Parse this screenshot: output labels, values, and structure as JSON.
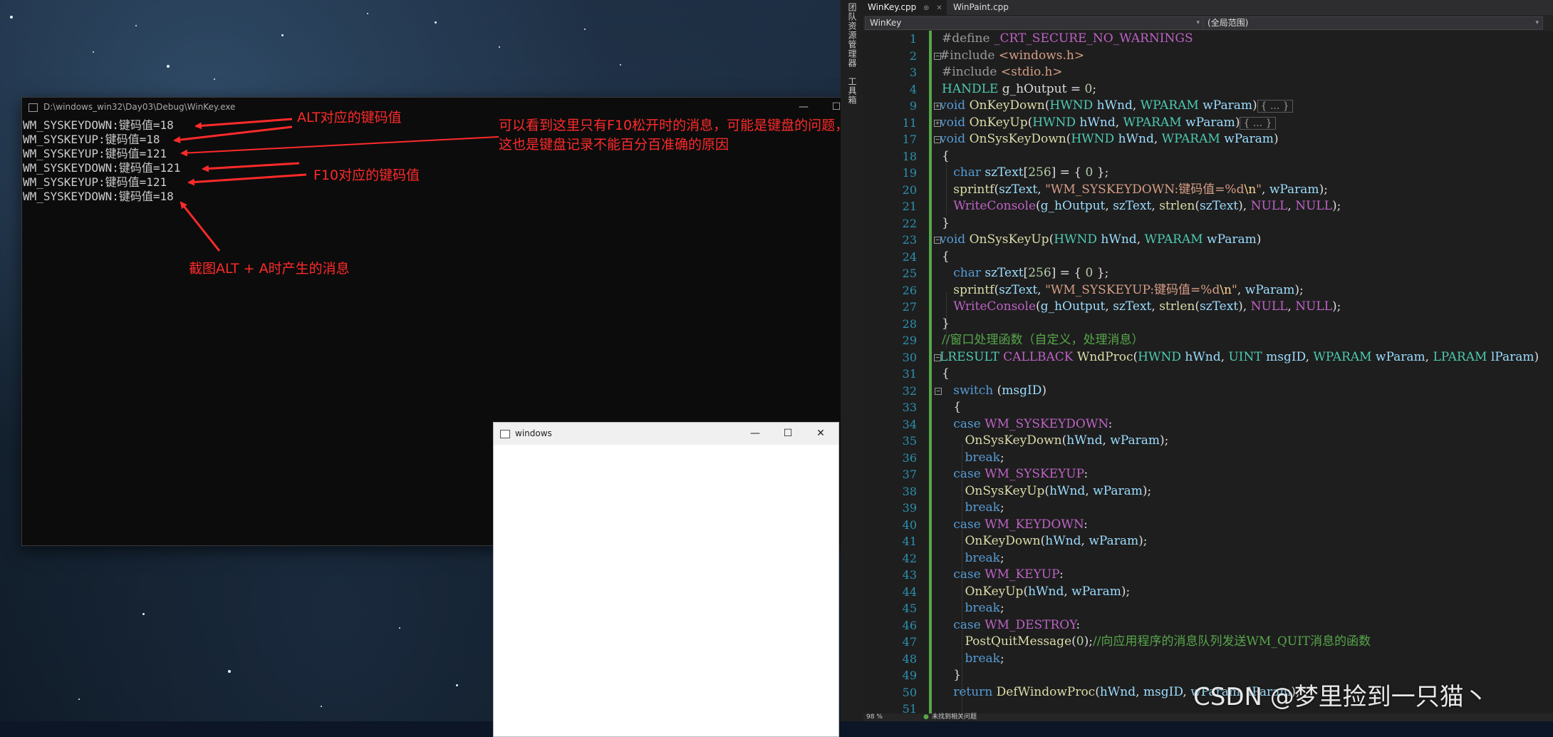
{
  "console": {
    "title": "D:\\windows_win32\\Day03\\Debug\\WinKey.exe",
    "lines": [
      "WM_SYSKEYDOWN:键码值=18",
      "WM_SYSKEYUP:键码值=18",
      "WM_SYSKEYUP:键码值=121",
      "WM_SYSKEYDOWN:键码值=121",
      "WM_SYSKEYUP:键码值=121",
      "WM_SYSKEYDOWN:键码值=18"
    ],
    "minimize": "—",
    "maximize": "☐",
    "close": "✕"
  },
  "annotations": {
    "alt_key": "ALT对应的键码值",
    "note_line1": "可以看到这里只有F10松开时的消息，可能是键盘的问题，",
    "note_line2": "这也是键盘记录不能百分百准确的原因",
    "f10_key": "F10对应的键码值",
    "screenshot": "截图ALT + A时产生的消息",
    "color": "#ff2a2a"
  },
  "small_window": {
    "title": "windows",
    "minimize": "—",
    "maximize": "☐",
    "close": "✕"
  },
  "sidebar": {
    "labels": [
      "团队资源管理器",
      "工具箱"
    ]
  },
  "editor": {
    "tabs": [
      {
        "label": "WinKey.cpp",
        "pin": "⊕",
        "close": "✕"
      },
      {
        "label": "WinPaint.cpp"
      }
    ],
    "nav_left": "WinKey",
    "nav_right": "(全局范围)",
    "line_numbers": [
      "1",
      "2",
      "3",
      "4",
      "9",
      "11",
      "17",
      "18",
      "19",
      "20",
      "21",
      "22",
      "23",
      "24",
      "25",
      "26",
      "27",
      "28",
      "29",
      "30",
      "31",
      "32",
      "33",
      "34",
      "35",
      "36",
      "37",
      "38",
      "39",
      "40",
      "41",
      "42",
      "43",
      "44",
      "45",
      "46",
      "47",
      "48",
      "49",
      "50",
      "51"
    ],
    "status": {
      "zoom": "98 %",
      "issues": "未找到相关问题"
    }
  },
  "watermark": "CSDN @梦里捡到一只猫丶"
}
